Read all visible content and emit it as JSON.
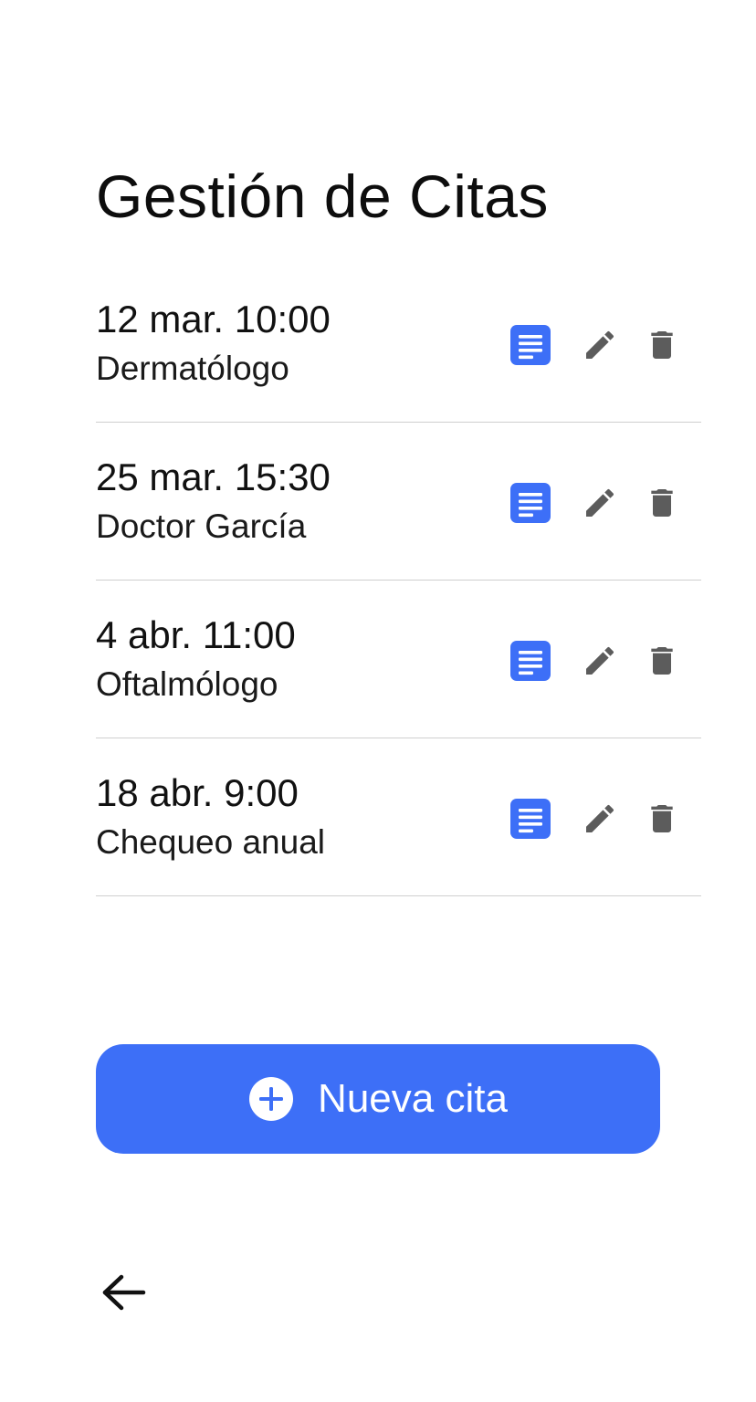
{
  "page": {
    "title": "Gestión de Citas"
  },
  "appointments": [
    {
      "datetime": "12 mar. 10:00",
      "description": "Dermatólogo"
    },
    {
      "datetime": "25 mar. 15:30",
      "description": "Doctor García"
    },
    {
      "datetime": "4 abr. 11:00",
      "description": "Oftalmólogo"
    },
    {
      "datetime": "18 abr. 9:00",
      "description": "Chequeo anual"
    }
  ],
  "row_actions": {
    "icons": [
      "notes-icon",
      "pencil-icon",
      "trash-icon"
    ]
  },
  "new_button": {
    "label": "Nueva cita",
    "icon": "plus-circle-icon"
  },
  "back_button": {
    "icon": "arrow-left-icon"
  },
  "colors": {
    "accent": "#3d6ff7",
    "icon_gray": "#5c5c5c",
    "divider": "#cfcfcf",
    "text": "#111111",
    "background": "#ffffff"
  }
}
